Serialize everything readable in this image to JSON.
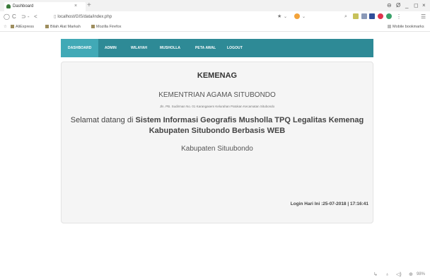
{
  "browser": {
    "tab_title": "Dashboard",
    "tab_close": "×",
    "new_tab": "+",
    "window_controls": [
      "⊖",
      "Ø",
      "_",
      "◻",
      "×"
    ],
    "nav_buttons": [
      "◯",
      "C",
      "⊃ -",
      "<"
    ],
    "url": "localhost/GIS/data/index.php",
    "bookmarks": [
      "AliExpress",
      "Bilah Alat Markah",
      "Mozilla Firefox"
    ],
    "mobile_bookmarks": "Mobile bookmarks",
    "status_icons": [
      "↳",
      "♁",
      "◁)",
      "⊕",
      "98%"
    ]
  },
  "site": {
    "nav": [
      "DASHBOARD",
      "ADMIN",
      "WILAYAH",
      "MUSHOLLA",
      "PETA AWAL",
      "LOGOUT"
    ],
    "heading": "KEMENAG",
    "office": "KEMENTRIAN AGAMA SITUBONDO",
    "address": "Jln. PB. Sudirman No. 01 Karangasem Kelurahan Patokan Kecamatan Situbondo",
    "welcome_prefix": "Selamat datang di ",
    "welcome_bold": "Sistem Informasi Geografis Musholla TPQ Legalitas Kemenag",
    "welcome_line2": "Kabupaten Situbondo Berbasis WEB",
    "regency": "Kabupaten Situubondo",
    "login_info": "Login Hari Ini :25-07-2018 | 17:16:41"
  },
  "colors": {
    "nav_bg": "#2e8a96",
    "nav_active": "#41a9b6"
  }
}
